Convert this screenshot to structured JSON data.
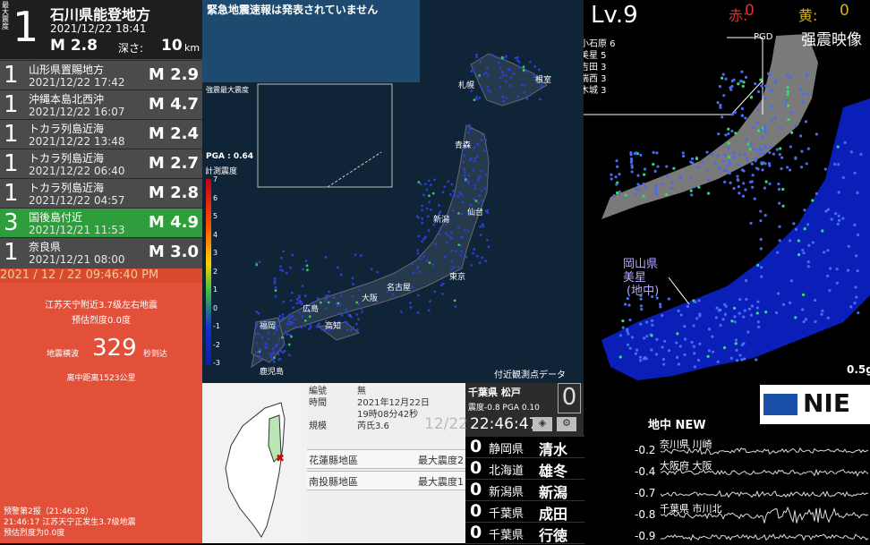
{
  "top_quake": {
    "label": "最大震度",
    "intensity": "1",
    "region": "石川県能登地方",
    "datetime": "2021/12/22 18:41",
    "magnitude": "M 2.8",
    "depth_label": "深さ:",
    "depth_value": "10",
    "depth_unit": "km"
  },
  "quake_list": [
    {
      "intensity": "1",
      "region": "山形県置賜地方",
      "datetime": "2021/12/22 17:42",
      "magnitude": "M 2.9"
    },
    {
      "intensity": "1",
      "region": "沖縄本島北西沖",
      "datetime": "2021/12/22 16:07",
      "magnitude": "M 4.7"
    },
    {
      "intensity": "1",
      "region": "トカラ列島近海",
      "datetime": "2021/12/22 13:48",
      "magnitude": "M 2.4"
    },
    {
      "intensity": "1",
      "region": "トカラ列島近海",
      "datetime": "2021/12/22 06:40",
      "magnitude": "M 2.7"
    },
    {
      "intensity": "1",
      "region": "トカラ列島近海",
      "datetime": "2021/12/22 04:57",
      "magnitude": "M 2.8"
    },
    {
      "intensity": "3",
      "region": "国後島付近",
      "datetime": "2021/12/21 11:53",
      "magnitude": "M 4.9"
    },
    {
      "intensity": "1",
      "region": "奈良県",
      "datetime": "2021/12/21 08:00",
      "magnitude": "M 3.0"
    }
  ],
  "clock_banner": "2021 / 12 / 22  09:46:40 PM",
  "eew_cn": {
    "headline": "江苏天宁附近3.7级左右地震",
    "forecast": "预估烈度0.0度",
    "arrival_label": "地震横波",
    "countdown": "329",
    "countdown_unit": "秒到达",
    "distance": "离中距离1523公里",
    "report_title": "预警第2报（21:46:28）",
    "report_line": "21:46:17 江苏天宁正发生3.7级地震",
    "report_forecast": "预估烈度为0.0度"
  },
  "map": {
    "eew_status": "緊急地震速報は発表されていません",
    "inset_label": "強震最大震度",
    "pga_label": "PGA : 0.64",
    "scale_label": "計測震度",
    "scale_ticks": [
      "7",
      "6",
      "5",
      "4",
      "3",
      "2",
      "1",
      "0",
      "-1",
      "-2",
      "-3"
    ],
    "cities": [
      "札幌",
      "根室",
      "青森",
      "仙台",
      "新潟",
      "東京",
      "名古屋",
      "大阪",
      "広島",
      "高知",
      "福岡",
      "鹿児島"
    ],
    "nearby_label": "付近観測点データ"
  },
  "taiwan": {
    "rows": [
      {
        "k": "編號",
        "v": "無"
      },
      {
        "k": "時間",
        "v": "2021年12月22日"
      },
      {
        "k": "",
        "v": "19時08分42秒"
      },
      {
        "k": "規模",
        "v": "芮氏3.6"
      }
    ],
    "areas": [
      {
        "name": "花蓮縣地區",
        "max": "最大震度2"
      },
      {
        "name": "南投縣地區",
        "max": "最大震度1"
      }
    ]
  },
  "station": {
    "name": "千葉県 松戸",
    "detail": "震度-0.8  PGA  0.10",
    "intensity": "0",
    "time": "22:46:47",
    "ghost_time": "12/22"
  },
  "station_list": [
    {
      "i": "0",
      "pref": "静岡県",
      "city": "清水"
    },
    {
      "i": "0",
      "pref": "北海道",
      "city": "雄冬"
    },
    {
      "i": "0",
      "pref": "新潟県",
      "city": "新潟"
    },
    {
      "i": "0",
      "pref": "千葉県",
      "city": "成田"
    },
    {
      "i": "0",
      "pref": "千葉県",
      "city": "行徳"
    }
  ],
  "strong": {
    "level": "Lv.9",
    "red_label": "赤:",
    "red_val": "0",
    "yellow_label": "黄:",
    "yellow_val": "0",
    "pgd": "PGD",
    "title": "强震映像",
    "ranks": [
      "小石原 6",
      "美星 5",
      "吉田 3",
      "瑞西 3",
      "木城 3"
    ],
    "callout": "岡山県\n美星\n(地中)",
    "callout_lines": [
      "岡山県",
      "美星",
      "(地中)"
    ],
    "scale": "0.5g",
    "footer": "地中 NEW",
    "logo": "NIE"
  },
  "waves": [
    {
      "val": "-0.2",
      "label": "奈川県 川崎"
    },
    {
      "val": "-0.4",
      "label": "大阪府 大阪"
    },
    {
      "val": "-0.7",
      "label": ""
    },
    {
      "val": "-0.8",
      "label": "千葉県 市川北"
    },
    {
      "val": "-0.9",
      "label": ""
    }
  ]
}
